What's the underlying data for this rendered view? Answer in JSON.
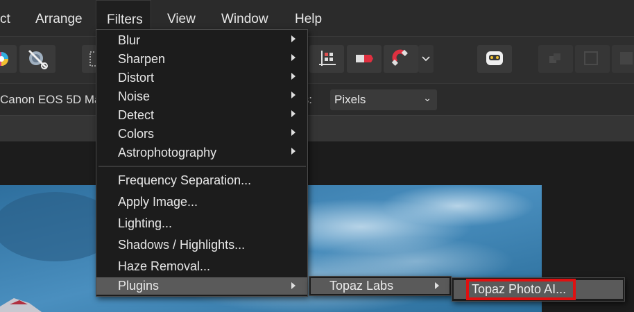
{
  "menubar": {
    "items": [
      {
        "label": "ct"
      },
      {
        "label": "Arrange"
      },
      {
        "label": "Filters"
      },
      {
        "label": "View"
      },
      {
        "label": "Window"
      },
      {
        "label": "Help"
      }
    ]
  },
  "contextbar": {
    "lens_label": "Canon EOS 5D Ma",
    "units_label": "ts:",
    "units_value": "Pixels"
  },
  "filters_menu": {
    "items": [
      {
        "label": "Blur",
        "submenu": true
      },
      {
        "label": "Sharpen",
        "submenu": true
      },
      {
        "label": "Distort",
        "submenu": true
      },
      {
        "label": "Noise",
        "submenu": true
      },
      {
        "label": "Detect",
        "submenu": true
      },
      {
        "label": "Colors",
        "submenu": true
      },
      {
        "label": "Astrophotography",
        "submenu": true
      },
      {
        "label": "Frequency Separation..."
      },
      {
        "label": "Apply Image..."
      },
      {
        "label": "Lighting..."
      },
      {
        "label": "Shadows / Highlights..."
      },
      {
        "label": "Haze Removal..."
      },
      {
        "label": "Plugins",
        "submenu": true,
        "highlighted": true
      }
    ]
  },
  "plugins_submenu": {
    "items": [
      {
        "label": "Topaz Labs",
        "submenu": true,
        "highlighted": true
      }
    ]
  },
  "topaz_submenu": {
    "items": [
      {
        "label": "Topaz Photo AI...",
        "highlighted": true
      }
    ]
  },
  "colors": {
    "menu_bg": "#1c1c1c",
    "highlight": "#5a5a5a",
    "callout": "#e01010",
    "sky": "#3f86b5"
  }
}
